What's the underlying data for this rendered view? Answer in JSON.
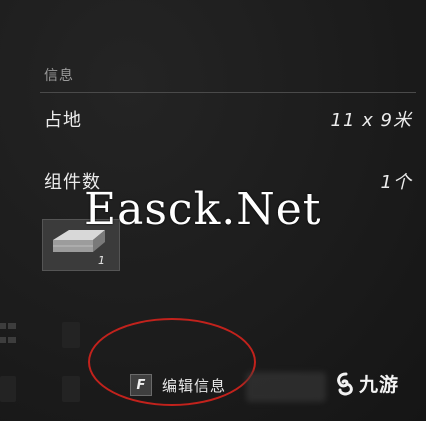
{
  "info_panel": {
    "section_title": "信息",
    "rows": [
      {
        "label": "占地",
        "value": "11 x 9米"
      },
      {
        "label": "组件数",
        "value": "1个"
      }
    ],
    "component_tile": {
      "count": "1"
    }
  },
  "action": {
    "key": "F",
    "label": "编辑信息"
  },
  "watermark": "Easck.Net",
  "logo": {
    "text": "九游",
    "icon": "swirl-logo-icon"
  },
  "colors": {
    "panel_bg": "#1b1b1b",
    "highlight_ring": "#c2221c",
    "text": "#ececec"
  }
}
